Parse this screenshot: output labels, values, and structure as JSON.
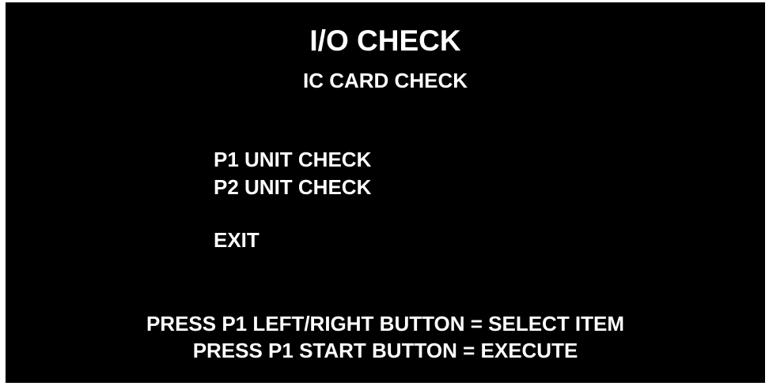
{
  "screen": {
    "title": "I/O CHECK",
    "subtitle": "IC CARD CHECK",
    "menu_items": [
      "P1 UNIT CHECK",
      "P2 UNIT CHECK",
      "EXIT"
    ],
    "instructions": [
      "PRESS P1 LEFT/RIGHT BUTTON = SELECT ITEM",
      "PRESS P1 START BUTTON = EXECUTE"
    ],
    "colors": {
      "background": "#000000",
      "text": "#ffffff"
    }
  }
}
